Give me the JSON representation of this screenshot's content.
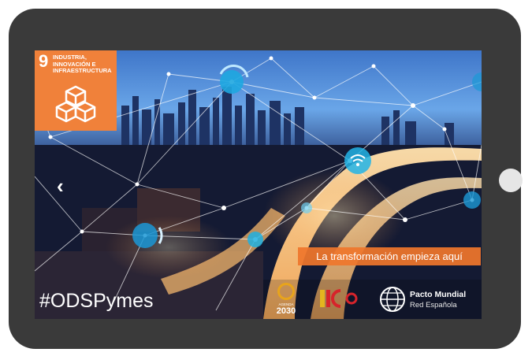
{
  "sdg": {
    "number": "9",
    "title": "INDUSTRIA, INNOVACIÓN E INFRAESTRUCTURA",
    "color": "#f0813a",
    "icon": "cubes-icon"
  },
  "slide": {
    "prev_icon": "chevron-left-icon",
    "prev_glyph": "‹",
    "tagline": "La transformación empieza aquí",
    "hashtag": "#ODSPymes"
  },
  "logos": {
    "agenda_line1": "AGENDA",
    "agenda_line2": "2030",
    "pacto_title": "Pacto Mundial",
    "pacto_subtitle": "Red Española"
  }
}
